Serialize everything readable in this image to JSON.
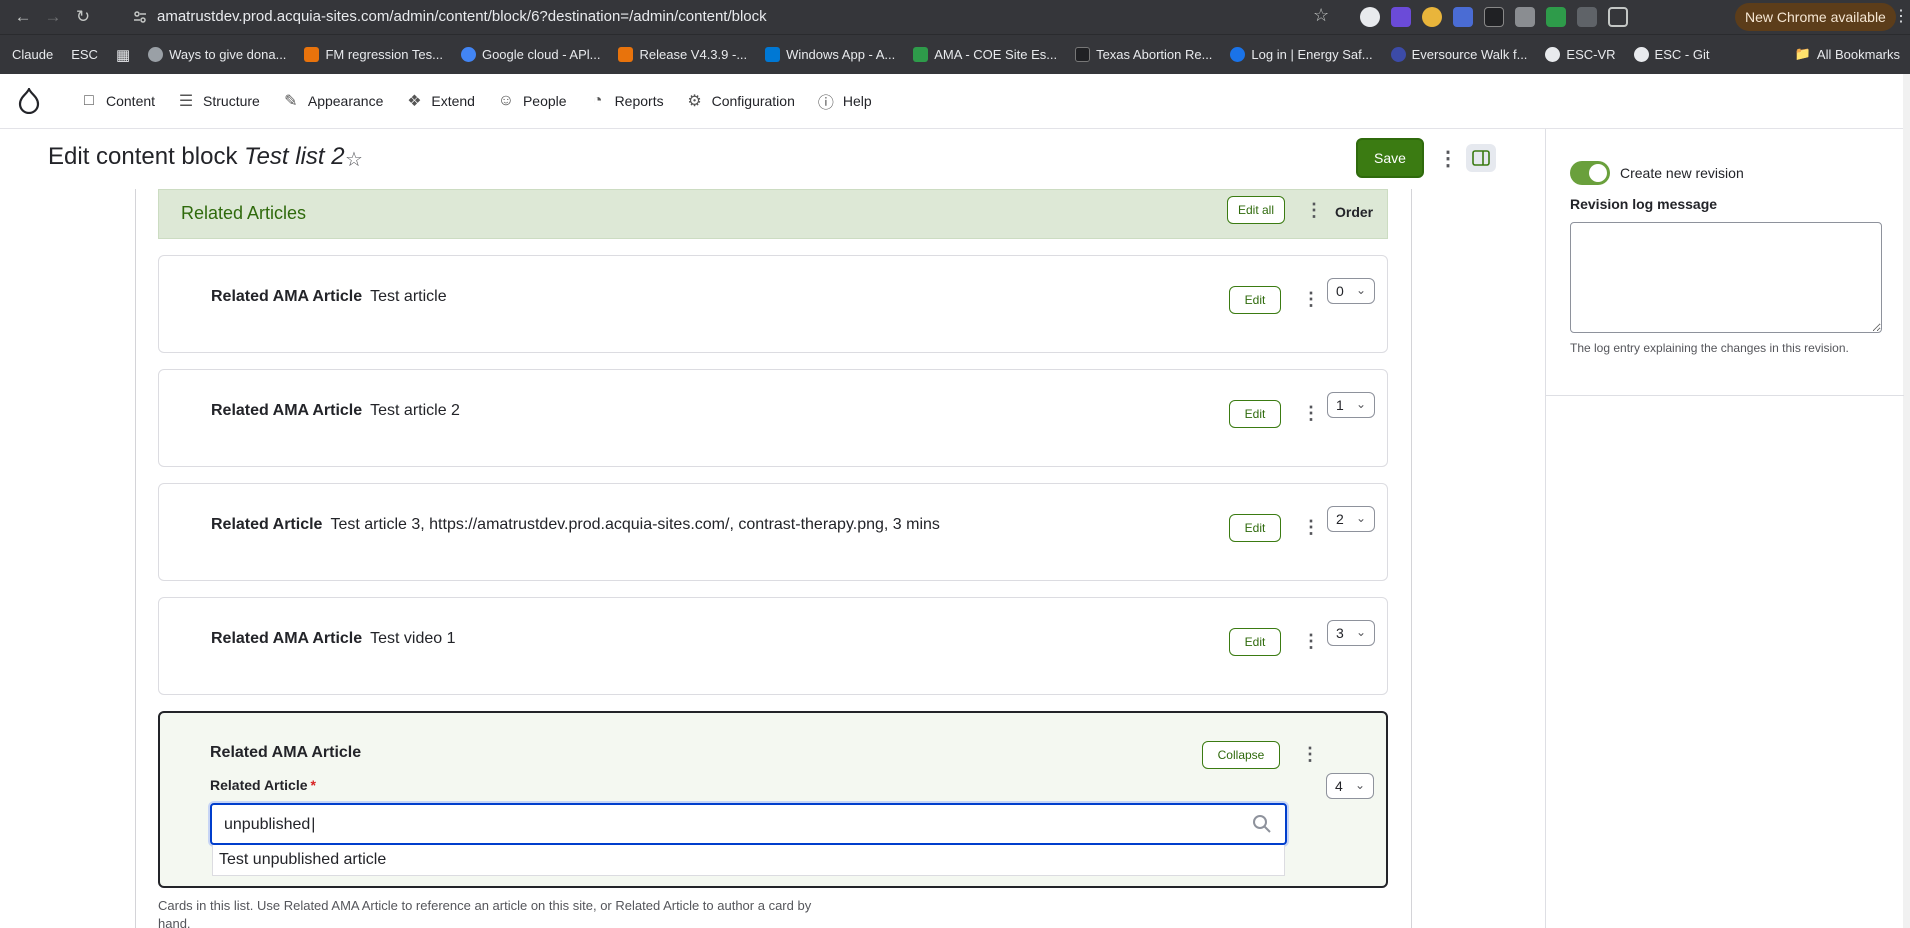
{
  "browser": {
    "url": "amatrustdev.prod.acquia-sites.com/admin/content/block/6?destination=/admin/content/block",
    "new_chrome_label": "New Chrome available",
    "bookmarks": [
      {
        "label": "Claude",
        "color": "#35363a"
      },
      {
        "label": "ESC",
        "color": "#35363a"
      },
      {
        "label": "Ways to give dona...",
        "color": "#9aa0a6"
      },
      {
        "label": "FM regression Tes...",
        "color": "#e8730c"
      },
      {
        "label": "Google cloud - APl...",
        "color": "#4285f4"
      },
      {
        "label": "Release V4.3.9 -...",
        "color": "#e8730c"
      },
      {
        "label": "Windows App - A...",
        "color": "#0078d4"
      },
      {
        "label": "AMA - COE Site Es...",
        "color": "#2e9b4a"
      },
      {
        "label": "Texas Abortion Re...",
        "color": "#202124"
      },
      {
        "label": "Log in | Energy Saf...",
        "color": "#1a73e8"
      },
      {
        "label": "Eversource Walk f...",
        "color": "#3c4ba8"
      },
      {
        "label": "ESC-VR",
        "color": "#e8eaed"
      },
      {
        "label": "ESC - Git",
        "color": "#e8eaed"
      }
    ],
    "all_bookmarks": "All Bookmarks"
  },
  "toolbar": {
    "items": [
      {
        "label": "Content",
        "icon": "document-icon"
      },
      {
        "label": "Structure",
        "icon": "layers-icon"
      },
      {
        "label": "Appearance",
        "icon": "brush-icon"
      },
      {
        "label": "Extend",
        "icon": "puzzle-icon"
      },
      {
        "label": "People",
        "icon": "people-icon"
      },
      {
        "label": "Reports",
        "icon": "chart-icon"
      },
      {
        "label": "Configuration",
        "icon": "gear-icon"
      },
      {
        "label": "Help",
        "icon": "help-icon"
      }
    ]
  },
  "header": {
    "title_prefix": "Edit content block ",
    "title_name": "Test list 2",
    "save_label": "Save"
  },
  "sidebar": {
    "create_revision_label": "Create new revision",
    "create_revision_on": true,
    "revision_log_label": "Revision log message",
    "revision_log_value": "",
    "revision_log_desc": "The log entry explaining the changes in this revision."
  },
  "section": {
    "title": "Related Articles",
    "edit_all_label": "Edit all",
    "order_label": "Order"
  },
  "cards": [
    {
      "type": "Related AMA Article",
      "value": "Test article",
      "edit_label": "Edit",
      "weight": "0"
    },
    {
      "type": "Related AMA Article",
      "value": "Test article 2",
      "edit_label": "Edit",
      "weight": "1"
    },
    {
      "type": "Related Article",
      "value": "Test article 3, https://amatrustdev.prod.acquia-sites.com/, contrast-therapy.png, 3 mins",
      "edit_label": "Edit",
      "weight": "2"
    },
    {
      "type": "Related AMA Article",
      "value": "Test video 1",
      "edit_label": "Edit",
      "weight": "3"
    }
  ],
  "open_card": {
    "type": "Related AMA Article",
    "collapse_label": "Collapse",
    "weight": "4",
    "field_label": "Related Article",
    "required_mark": "*",
    "search_value": "unpublished",
    "suggestion": "Test unpublished article"
  },
  "help_text": "Cards in this list. Use Related AMA Article to reference an article on this site, or Related Article to author a card by hand.",
  "colors": {
    "accent_green": "#3b7b12",
    "section_bg": "#dde8d6",
    "focus_blue": "#003ecc"
  }
}
